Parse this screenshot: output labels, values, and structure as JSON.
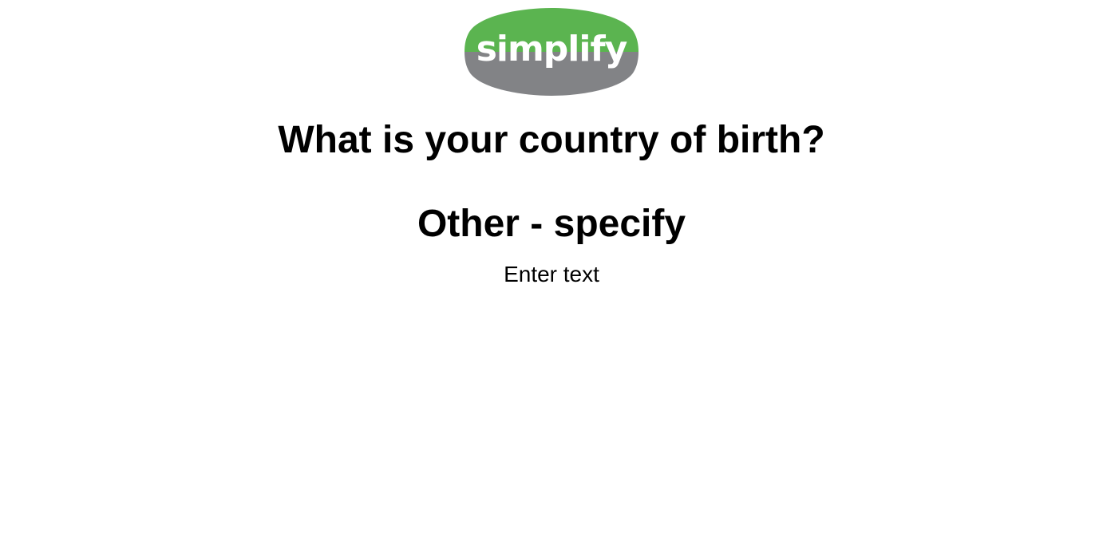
{
  "logo": {
    "text": "simplify",
    "colors": {
      "top": "#5bb450",
      "bottom": "#828386",
      "text": "#ffffff"
    }
  },
  "question": {
    "title": "What is your country of birth?",
    "option_label": "Other - specify"
  },
  "input": {
    "value": "",
    "placeholder": "Enter text"
  }
}
